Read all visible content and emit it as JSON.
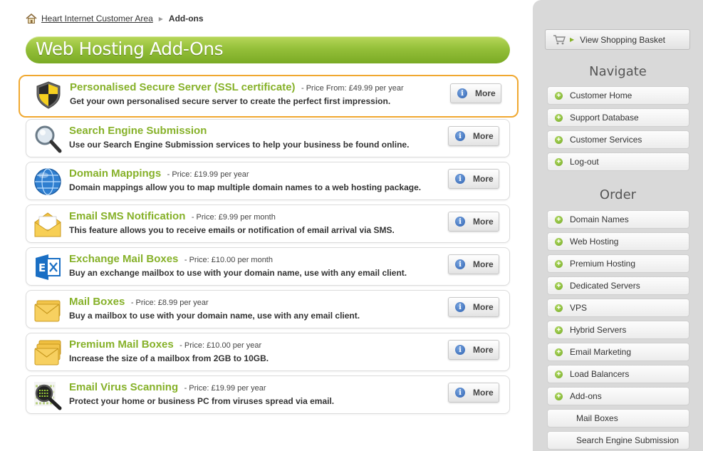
{
  "breadcrumb": {
    "home_link": "Heart Internet Customer Area",
    "current": "Add-ons"
  },
  "page_title": "Web Hosting Add-Ons",
  "more_label": "More",
  "products": [
    {
      "name": "Personalised Secure Server (SSL certificate)",
      "price": "- Price From: £49.99 per year",
      "desc": "Get your own personalised secure server to create the perfect first impression.",
      "icon": "shield-icon"
    },
    {
      "name": "Search Engine Submission",
      "price": "",
      "desc": "Use our Search Engine Submission services to help your business be found online.",
      "icon": "magnifier-icon"
    },
    {
      "name": "Domain Mappings",
      "price": "- Price: £19.99 per year",
      "desc": "Domain mappings allow you to map multiple domain names to a web hosting package.",
      "icon": "globe-icon"
    },
    {
      "name": "Email SMS Notification",
      "price": "- Price: £9.99 per month",
      "desc": "This feature allows you to receive emails or notification of email arrival via SMS.",
      "icon": "envelope-open-icon"
    },
    {
      "name": "Exchange Mail Boxes",
      "price": "- Price: £10.00 per month",
      "desc": "Buy an exchange mailbox to use with your domain name, use with any email client.",
      "icon": "exchange-icon"
    },
    {
      "name": "Mail Boxes",
      "price": "- Price: £8.99 per year",
      "desc": "Buy a mailbox to use with your domain name, use with any email client.",
      "icon": "mail-stack-icon"
    },
    {
      "name": "Premium Mail Boxes",
      "price": "- Price: £10.00 per year",
      "desc": "Increase the size of a mailbox from 2GB to 10GB.",
      "icon": "mail-stack-icon"
    },
    {
      "name": "Email Virus Scanning",
      "price": "- Price: £19.99 per year",
      "desc": "Protect your home or business PC from viruses spread via email.",
      "icon": "virus-scan-icon"
    }
  ],
  "sidebar": {
    "basket_label": "View Shopping Basket",
    "navigate_heading": "Navigate",
    "navigate_items": [
      "Customer Home",
      "Support Database",
      "Customer Services",
      "Log-out"
    ],
    "order_heading": "Order",
    "order_items": [
      "Domain Names",
      "Web Hosting",
      "Premium Hosting",
      "Dedicated Servers",
      "VPS",
      "Hybrid Servers",
      "Email Marketing",
      "Load Balancers",
      "Add-ons"
    ],
    "addon_subitems": [
      "Mail Boxes",
      "Search Engine Submission"
    ]
  },
  "colors": {
    "accent_green": "#86b129",
    "selected_border": "#f0a830",
    "sidebar_bg": "#d9d9d9"
  }
}
